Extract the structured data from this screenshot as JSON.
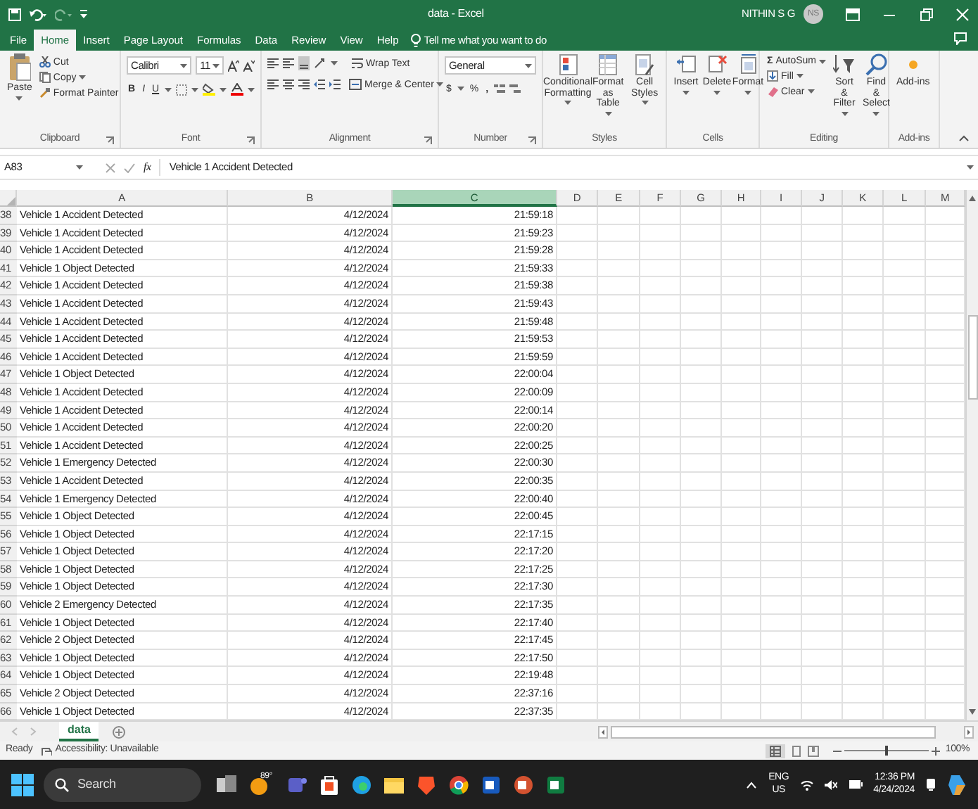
{
  "window": {
    "title": "data - Excel",
    "user": "NITHIN S G",
    "avatar": "NS"
  },
  "tabs": [
    {
      "label": "File",
      "selected": false
    },
    {
      "label": "Home",
      "selected": true
    },
    {
      "label": "Insert",
      "selected": false
    },
    {
      "label": "Page Layout",
      "selected": false
    },
    {
      "label": "Formulas",
      "selected": false
    },
    {
      "label": "Data",
      "selected": false
    },
    {
      "label": "Review",
      "selected": false
    },
    {
      "label": "View",
      "selected": false
    },
    {
      "label": "Help",
      "selected": false
    }
  ],
  "tell_me": "Tell me what you want to do",
  "ribbon": {
    "clipboard": {
      "label": "Clipboard",
      "paste": "Paste",
      "cut": "Cut",
      "copy": "Copy",
      "format_painter": "Format Painter"
    },
    "font": {
      "label": "Font",
      "name": "Calibri",
      "size": "11",
      "bold": "B",
      "italic": "I",
      "underline": "U"
    },
    "alignment": {
      "label": "Alignment",
      "wrap": "Wrap Text",
      "merge": "Merge & Center"
    },
    "number": {
      "label": "Number",
      "format": "General",
      "currency": "$",
      "percent": "%",
      "comma": ","
    },
    "styles": {
      "label": "Styles",
      "buttons": [
        "Conditional Formatting",
        "Format as Table",
        "Cell Styles"
      ]
    },
    "cells": {
      "label": "Cells",
      "buttons": [
        "Insert",
        "Delete",
        "Format"
      ]
    },
    "editing": {
      "label": "Editing",
      "sigma": "Σ",
      "autosum": "AutoSum",
      "fill": "Fill",
      "clear": "Clear",
      "sort": "Sort & Filter",
      "find": "Find & Select"
    },
    "addins": {
      "label": "Add-ins",
      "button": "Add-ins"
    }
  },
  "formula_bar": {
    "name_box": "A83",
    "fx": "fx",
    "content": "Vehicle 1 Accident Detected"
  },
  "columns": [
    {
      "label": "A",
      "selected": false
    },
    {
      "label": "B",
      "selected": false
    },
    {
      "label": "C",
      "selected": true
    },
    {
      "label": "D",
      "selected": false
    },
    {
      "label": "E",
      "selected": false
    },
    {
      "label": "F",
      "selected": false
    },
    {
      "label": "G",
      "selected": false
    },
    {
      "label": "H",
      "selected": false
    },
    {
      "label": "I",
      "selected": false
    },
    {
      "label": "J",
      "selected": false
    },
    {
      "label": "K",
      "selected": false
    },
    {
      "label": "L",
      "selected": false
    },
    {
      "label": "M",
      "selected": false
    }
  ],
  "rows": [
    {
      "n": "38",
      "a": "Vehicle 1 Accident Detected",
      "b": "4/12/2024",
      "c": "21:59:18"
    },
    {
      "n": "39",
      "a": "Vehicle 1 Accident Detected",
      "b": "4/12/2024",
      "c": "21:59:23"
    },
    {
      "n": "40",
      "a": "Vehicle 1 Accident Detected",
      "b": "4/12/2024",
      "c": "21:59:28"
    },
    {
      "n": "41",
      "a": "Vehicle 1 Object Detected",
      "b": "4/12/2024",
      "c": "21:59:33"
    },
    {
      "n": "42",
      "a": "Vehicle 1 Accident Detected",
      "b": "4/12/2024",
      "c": "21:59:38"
    },
    {
      "n": "43",
      "a": "Vehicle 1 Accident Detected",
      "b": "4/12/2024",
      "c": "21:59:43"
    },
    {
      "n": "44",
      "a": "Vehicle 1 Accident Detected",
      "b": "4/12/2024",
      "c": "21:59:48"
    },
    {
      "n": "45",
      "a": "Vehicle 1 Accident Detected",
      "b": "4/12/2024",
      "c": "21:59:53"
    },
    {
      "n": "46",
      "a": "Vehicle 1 Accident Detected",
      "b": "4/12/2024",
      "c": "21:59:59"
    },
    {
      "n": "47",
      "a": "Vehicle 1 Object Detected",
      "b": "4/12/2024",
      "c": "22:00:04"
    },
    {
      "n": "48",
      "a": "Vehicle 1 Accident Detected",
      "b": "4/12/2024",
      "c": "22:00:09"
    },
    {
      "n": "49",
      "a": "Vehicle 1 Accident Detected",
      "b": "4/12/2024",
      "c": "22:00:14"
    },
    {
      "n": "50",
      "a": "Vehicle 1 Accident Detected",
      "b": "4/12/2024",
      "c": "22:00:20"
    },
    {
      "n": "51",
      "a": "Vehicle 1 Accident Detected",
      "b": "4/12/2024",
      "c": "22:00:25"
    },
    {
      "n": "52",
      "a": "Vehicle 1 Emergency Detected",
      "b": "4/12/2024",
      "c": "22:00:30"
    },
    {
      "n": "53",
      "a": "Vehicle 1 Accident Detected",
      "b": "4/12/2024",
      "c": "22:00:35"
    },
    {
      "n": "54",
      "a": "Vehicle 1 Emergency Detected",
      "b": "4/12/2024",
      "c": "22:00:40"
    },
    {
      "n": "55",
      "a": "Vehicle 1 Object Detected",
      "b": "4/12/2024",
      "c": "22:00:45"
    },
    {
      "n": "56",
      "a": "Vehicle 1 Object Detected",
      "b": "4/12/2024",
      "c": "22:17:15"
    },
    {
      "n": "57",
      "a": "Vehicle 1 Object Detected",
      "b": "4/12/2024",
      "c": "22:17:20"
    },
    {
      "n": "58",
      "a": "Vehicle 1 Object Detected",
      "b": "4/12/2024",
      "c": "22:17:25"
    },
    {
      "n": "59",
      "a": "Vehicle 1 Object Detected",
      "b": "4/12/2024",
      "c": "22:17:30"
    },
    {
      "n": "60",
      "a": "Vehicle 2 Emergency Detected",
      "b": "4/12/2024",
      "c": "22:17:35"
    },
    {
      "n": "61",
      "a": "Vehicle 1 Object Detected",
      "b": "4/12/2024",
      "c": "22:17:40"
    },
    {
      "n": "62",
      "a": "Vehicle 2 Object Detected",
      "b": "4/12/2024",
      "c": "22:17:45"
    },
    {
      "n": "63",
      "a": "Vehicle 1 Object Detected",
      "b": "4/12/2024",
      "c": "22:17:50"
    },
    {
      "n": "64",
      "a": "Vehicle 1 Object Detected",
      "b": "4/12/2024",
      "c": "22:19:48"
    },
    {
      "n": "65",
      "a": "Vehicle 2 Object Detected",
      "b": "4/12/2024",
      "c": "22:37:16"
    },
    {
      "n": "66",
      "a": "Vehicle 1 Object Detected",
      "b": "4/12/2024",
      "c": "22:37:35"
    }
  ],
  "sheets": [
    {
      "label": "data",
      "selected": true
    }
  ],
  "status_bar": {
    "ready": "Ready",
    "accessibility": "Accessibility: Unavailable",
    "zoom": "100%",
    "zoom_level": {
      "level": 0.5
    }
  },
  "taskbar": {
    "search": "Search",
    "weather": "89°",
    "language": "ENG",
    "region": "US",
    "time": "12:36 PM",
    "date": "4/24/2024"
  }
}
